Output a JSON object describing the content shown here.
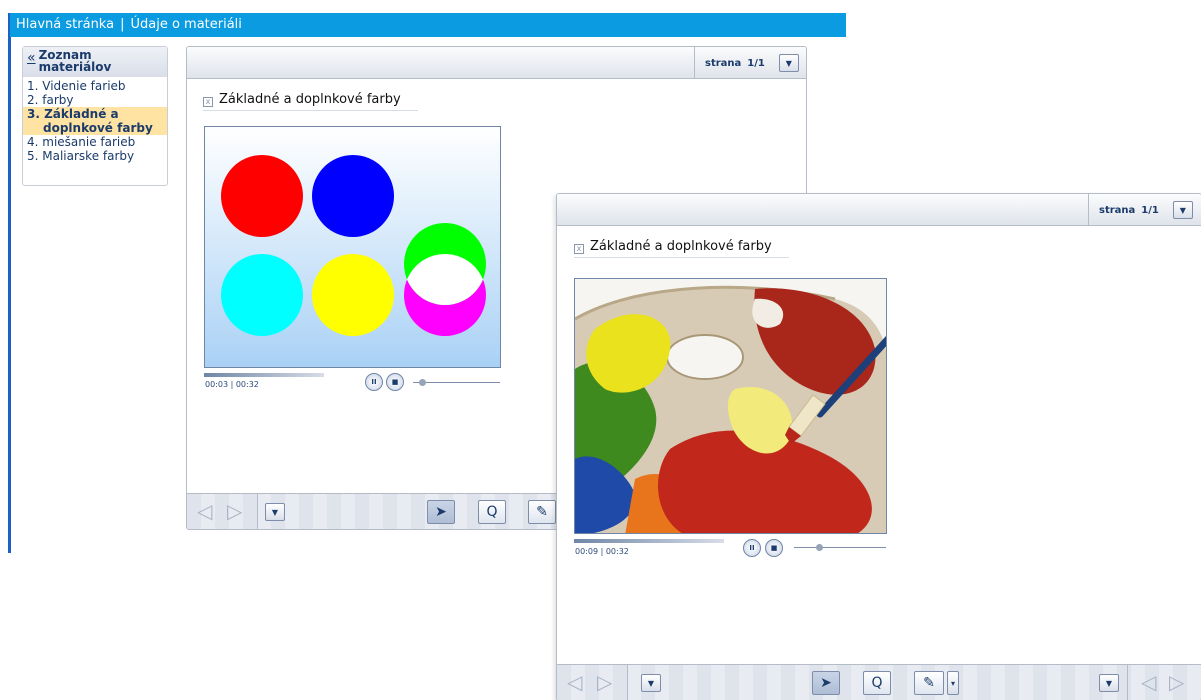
{
  "header": {
    "home_link": "Hlavná stránka",
    "separator": "|",
    "current": "Údaje o materiáli"
  },
  "sidebar": {
    "collapse_icon": "«",
    "title_line1": "Zoznam",
    "title_line2": "materiálov",
    "items": [
      {
        "label": "1. Videnie farieb"
      },
      {
        "label": "2. farby"
      },
      {
        "label_line1": "3. Základné a",
        "label_line2": "doplnkové farby",
        "active": true
      },
      {
        "label": "4. miešanie farieb"
      },
      {
        "label": "5. Maliarske farby"
      }
    ]
  },
  "viewer_back": {
    "page_label": "strana",
    "page_value": "1/1",
    "dropdown_icon": "▼",
    "item_title": "Základné a doplnkové farby",
    "close_icon": "x",
    "time_elapsed": "00:03",
    "time_total": "00:32",
    "pause_icon": "II",
    "stop_icon": "■",
    "progress": 0.09
  },
  "viewer_front": {
    "page_label": "strana",
    "page_value": "1/1",
    "dropdown_icon": "▼",
    "item_title": "Základné a doplnkové farby",
    "close_icon": "x",
    "time_elapsed": "00:09",
    "time_total": "00:32",
    "pause_icon": "II",
    "stop_icon": "■",
    "progress": 0.28
  },
  "toolbar": {
    "prev_icon": "◁",
    "next_icon": "▷",
    "menu_icon": "▼",
    "pointer_icon": "➤",
    "search_icon": "Q",
    "pen_icon": "✎",
    "pen_dropdown_icon": "▾"
  },
  "colors": {
    "header_bg": "#0a9be0",
    "active_item_bg": "#ffe3a3",
    "red": "#ff0000",
    "blue": "#0000ff",
    "cyan": "#00ffff",
    "yellow": "#ffff00",
    "green": "#00ff00",
    "magenta": "#ff00ff"
  }
}
